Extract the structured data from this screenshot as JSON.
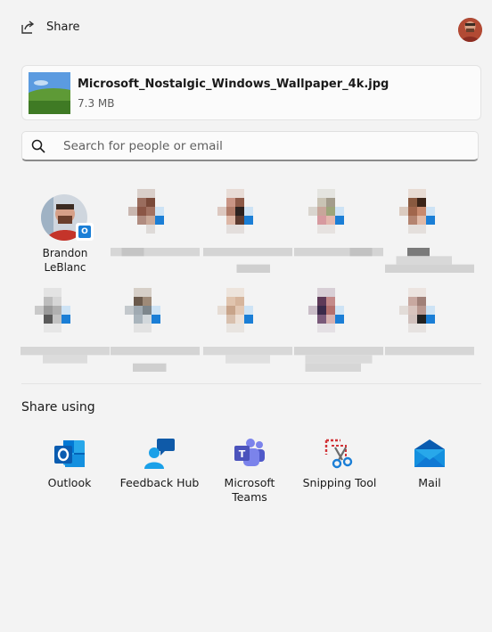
{
  "header": {
    "title": "Share",
    "share_icon": "share-icon",
    "avatar_icon": "user-avatar"
  },
  "file": {
    "name": "Microsoft_Nostalgic_Windows_Wallpaper_4k.jpg",
    "size": "7.3 MB"
  },
  "search": {
    "placeholder": "Search for people or email",
    "value": ""
  },
  "contacts": [
    {
      "first": "Brandon",
      "last": "LeBlanc",
      "badge": "outlook-badge"
    }
  ],
  "share_using": {
    "title": "Share using",
    "apps": [
      {
        "label": "Outlook",
        "icon": "outlook-icon"
      },
      {
        "label": "Feedback Hub",
        "icon": "feedback-hub-icon"
      },
      {
        "label_1": "Microsoft",
        "label_2": "Teams",
        "icon": "teams-icon"
      },
      {
        "label": "Snipping Tool",
        "icon": "snipping-tool-icon"
      },
      {
        "label": "Mail",
        "icon": "mail-icon"
      }
    ]
  },
  "colors": {
    "background": "#f3f3f3",
    "accent": "#1a7ed6"
  }
}
